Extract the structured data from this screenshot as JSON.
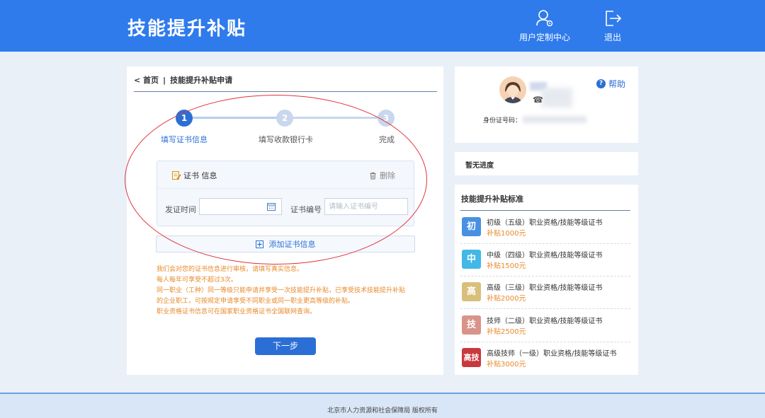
{
  "header": {
    "title": "技能提升补贴",
    "user_center_label": "用户定制中心",
    "logout_label": "退出"
  },
  "breadcrumb": {
    "home": "< 首页",
    "separator": "|",
    "current": "技能提升补贴申请"
  },
  "steps": [
    {
      "number": "1",
      "label": "填写证书信息"
    },
    {
      "number": "2",
      "label": "填写收款银行卡"
    },
    {
      "number": "3",
      "label": "完成"
    }
  ],
  "cert_form": {
    "section_title": "证书 信息",
    "delete_label": "删除",
    "issue_date_label": "发证时间",
    "issue_date_value": "",
    "cert_no_label": "证书编号",
    "cert_no_placeholder": "请输入证书编号"
  },
  "add_cert_label": "添加证书信息",
  "notes": [
    "我们会对您的证书信息进行审核，请填写真实信息。",
    "每人每年可享受不超过3次。",
    "同一职业（工种）同一等级只能申请并享受一次技能提升补贴，已享受技术技能提升补贴",
    "的企业职工，可按规定申请享受不同职业或同一职业更高等级的补贴。",
    "职业资格证书信息可在国家职业资格证书全国联网查询。"
  ],
  "next_label": "下一步",
  "profile": {
    "help_label": "帮助",
    "phone_icon": "☎",
    "id_label": "身份证号码："
  },
  "progress": {
    "label": "暂无进度"
  },
  "standards": {
    "title": "技能提升补贴标准",
    "items": [
      {
        "badge": "初",
        "color": "#4a90e2",
        "name": "初级（五级）职业资格/技能等级证书",
        "amount": "补贴1000元"
      },
      {
        "badge": "中",
        "color": "#42b8e6",
        "name": "中级（四级）职业资格/技能等级证书",
        "amount": "补贴1500元"
      },
      {
        "badge": "高",
        "color": "#d8c07a",
        "name": "高级（三级）职业资格/技能等级证书",
        "amount": "补贴2000元"
      },
      {
        "badge": "技",
        "color": "#d8938a",
        "name": "技师（二级）职业资格/技能等级证书",
        "amount": "补贴2500元"
      },
      {
        "badge": "高技",
        "color": "#c9383f",
        "name": "高级技师（一级）职业资格/技能等级证书",
        "amount": "补贴3000元"
      }
    ]
  },
  "footer": {
    "copyright": "北京市人力资源和社会保障局 版权所有"
  }
}
